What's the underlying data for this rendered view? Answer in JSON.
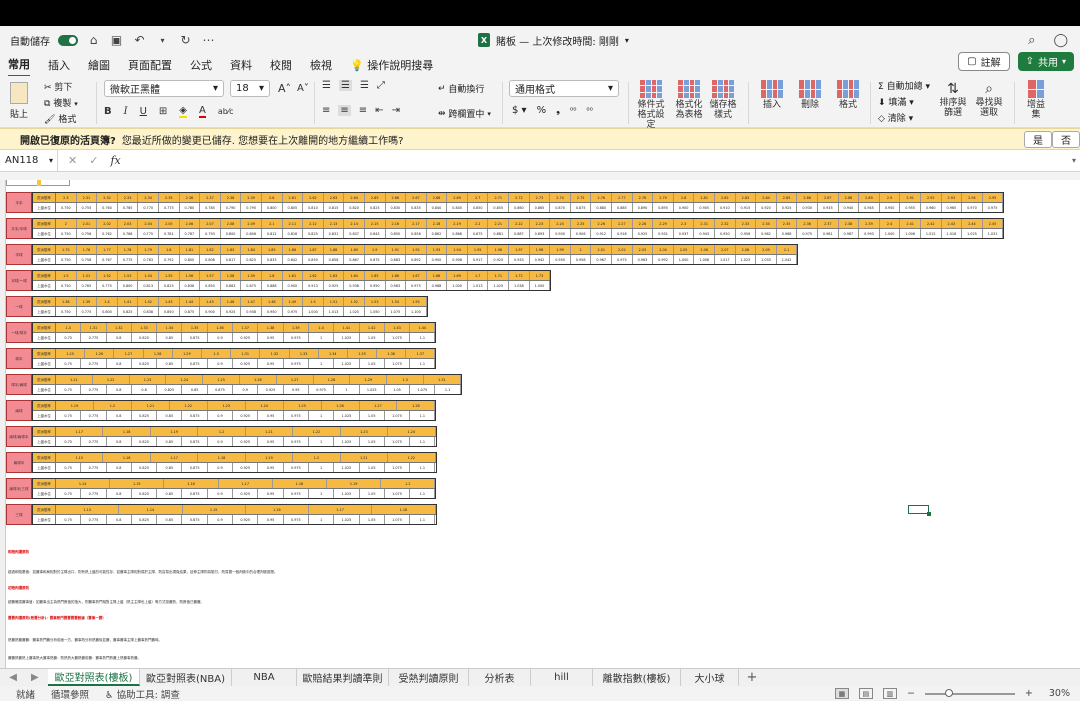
{
  "titlebar": {
    "autosave_label": "自動儲存",
    "title": "賭板 — 上次修改時間: 剛剛",
    "xl_glyph": "X"
  },
  "tabs": [
    "常用",
    "插入",
    "繪圖",
    "頁面配置",
    "公式",
    "資料",
    "校閱",
    "檢視"
  ],
  "tell_me": "操作說明搜尋",
  "comment_label": "註解",
  "share_label": "共用",
  "ribbon": {
    "paste": "貼上",
    "cut": "剪下",
    "copy": "複製",
    "format_painter": "格式",
    "font_name": "微軟正黑體",
    "font_size": "18",
    "wrap_text": "自動換行",
    "merge_center": "跨欄置中",
    "number_format": "通用格式",
    "conditional_format": "條件式\n格式設定",
    "format_as_table": "格式化\n為表格",
    "cell_styles": "儲存格\n樣式",
    "insert": "插入",
    "delete": "刪除",
    "format": "格式",
    "autosum": "自動加總",
    "fill": "填滿",
    "clear": "清除",
    "sort_filter": "排序與\n篩選",
    "find_select": "尋找與\n選取",
    "addins": "增益\n集"
  },
  "message_bar": {
    "title": "開啟已復原的活頁簿?",
    "text": "您最近所做的變更已儲存. 您想要在上次離開的地方繼續工作嗎?",
    "yes": "是",
    "no": "否"
  },
  "formula_bar": {
    "name_box": "AN118",
    "fx": "fx"
  },
  "sheet_tabs": [
    "歐亞對照表(樓板)",
    "歐亞對照表(NBA)",
    "NBA",
    "歐賠結果判讀準則",
    "受熱判讀原則",
    "分析表",
    "hill",
    "離散指數(樓板)",
    "大小球"
  ],
  "status": {
    "ready": "就緒",
    "circular": "循環參照",
    "accessibility": "協助工具: 調查",
    "zoom": "30%"
  },
  "blocks": [
    {
      "label": "平手",
      "top": "歐洲賠率",
      "bottom": "上盤水位",
      "odds": [
        "2.3",
        "2.31",
        "2.32",
        "2.33",
        "2.34",
        "2.35",
        "2.36",
        "2.37",
        "2.38",
        "2.39",
        "2.6",
        "2.61",
        "2.62",
        "2.63",
        "2.64",
        "2.65",
        "2.66",
        "2.67",
        "2.68",
        "2.69",
        "2.7",
        "2.71",
        "2.72",
        "2.73",
        "2.74",
        "2.75",
        "2.76",
        "2.77",
        "2.78",
        "2.79",
        "2.8",
        "2.81",
        "2.82",
        "2.83",
        "2.84",
        "2.85",
        "2.86",
        "2.87",
        "2.88",
        "2.89",
        "2.9",
        "2.91",
        "2.92",
        "2.93",
        "2.94",
        "2.95"
      ],
      "water": [
        "0.750",
        "0.755",
        "0.760",
        "0.765",
        "0.770",
        "0.775",
        "0.780",
        "0.785",
        "0.790",
        "0.795",
        "0.800",
        "0.805",
        "0.810",
        "0.815",
        "0.820",
        "0.825",
        "0.830",
        "0.835",
        "0.840",
        "0.845",
        "0.850",
        "0.855",
        "0.860",
        "0.865",
        "0.870",
        "0.875",
        "0.880",
        "0.885",
        "0.890",
        "0.895",
        "0.900",
        "0.905",
        "0.910",
        "0.915",
        "0.920",
        "0.925",
        "0.930",
        "0.935",
        "0.940",
        "0.945",
        "0.950",
        "0.955",
        "0.960",
        "0.965",
        "0.970",
        "0.975"
      ]
    },
    {
      "label": "平手/半球",
      "top": "歐洲賠率",
      "bottom": "上盤水位",
      "odds": [
        "2",
        "2.01",
        "2.02",
        "2.03",
        "2.04",
        "2.05",
        "2.06",
        "2.07",
        "2.08",
        "2.09",
        "2.1",
        "2.11",
        "2.12",
        "2.13",
        "2.14",
        "2.15",
        "2.16",
        "2.17",
        "2.18",
        "2.19",
        "2.2",
        "2.21",
        "2.22",
        "2.23",
        "2.24",
        "2.25",
        "2.26",
        "2.27",
        "2.28",
        "2.29",
        "2.3",
        "2.31",
        "2.32",
        "2.33",
        "2.34",
        "2.35",
        "2.36",
        "2.37",
        "2.38",
        "2.39",
        "2.4",
        "2.41",
        "2.42",
        "2.43",
        "2.44",
        "2.45"
      ],
      "water": [
        "0.750",
        "0.756",
        "0.762",
        "0.768",
        "0.775",
        "0.781",
        "0.787",
        "0.793",
        "0.800",
        "0.806",
        "0.812",
        "0.818",
        "0.825",
        "0.831",
        "0.837",
        "0.843",
        "0.850",
        "0.856",
        "0.862",
        "0.868",
        "0.875",
        "0.881",
        "0.887",
        "0.893",
        "0.900",
        "0.906",
        "0.912",
        "0.918",
        "0.925",
        "0.931",
        "0.937",
        "0.943",
        "0.950",
        "0.956",
        "0.962",
        "0.968",
        "0.975",
        "0.981",
        "0.987",
        "0.993",
        "1.000",
        "1.006",
        "1.012",
        "1.018",
        "1.025",
        "1.031"
      ]
    },
    {
      "label": "半球",
      "top": "歐洲賠率",
      "bottom": "上盤水位",
      "odds": [
        "1.75",
        "1.76",
        "1.77",
        "1.78",
        "1.79",
        "1.8",
        "1.81",
        "1.82",
        "1.83",
        "1.84",
        "1.85",
        "1.86",
        "1.87",
        "1.88",
        "1.89",
        "1.9",
        "1.91",
        "1.92",
        "1.93",
        "1.94",
        "1.95",
        "1.96",
        "1.97",
        "1.98",
        "1.99",
        "2",
        "2.01",
        "2.02",
        "2.03",
        "2.04",
        "2.05",
        "2.06",
        "2.07",
        "2.08",
        "2.09",
        "2.1"
      ],
      "water": [
        "0.750",
        "0.758",
        "0.767",
        "0.775",
        "0.783",
        "0.792",
        "0.800",
        "0.808",
        "0.817",
        "0.825",
        "0.833",
        "0.842",
        "0.850",
        "0.858",
        "0.867",
        "0.875",
        "0.883",
        "0.892",
        "0.900",
        "0.908",
        "0.917",
        "0.925",
        "0.933",
        "0.942",
        "0.950",
        "0.958",
        "0.967",
        "0.975",
        "0.983",
        "0.992",
        "1.000",
        "1.008",
        "1.017",
        "1.025",
        "1.033",
        "1.042"
      ]
    },
    {
      "label": "半球/一球",
      "top": "歐洲賠率",
      "bottom": "上盤水位",
      "odds": [
        "1.5",
        "1.51",
        "1.52",
        "1.53",
        "1.54",
        "1.55",
        "1.56",
        "1.57",
        "1.58",
        "1.59",
        "1.6",
        "1.61",
        "1.62",
        "1.63",
        "1.64",
        "1.65",
        "1.66",
        "1.67",
        "1.68",
        "1.69",
        "1.7",
        "1.71",
        "1.72",
        "1.73"
      ],
      "water": [
        "0.750",
        "0.765",
        "0.775",
        "0.800",
        "0.813",
        "0.825",
        "0.838",
        "0.850",
        "0.863",
        "0.875",
        "0.888",
        "0.900",
        "0.913",
        "0.925",
        "0.938",
        "0.950",
        "0.963",
        "0.975",
        "0.988",
        "1.000",
        "1.013",
        "1.025",
        "1.038",
        "1.050"
      ]
    },
    {
      "label": "一球",
      "top": "歐洲賠率",
      "bottom": "上盤水位",
      "odds": [
        "1.38",
        "1.39",
        "1.4",
        "1.41",
        "1.42",
        "1.43",
        "1.44",
        "1.45",
        "1.46",
        "1.47",
        "1.48",
        "1.49",
        "1.5",
        "1.51",
        "1.52",
        "1.53",
        "1.54",
        "1.55"
      ],
      "water": [
        "0.750",
        "0.775",
        "0.800",
        "0.825",
        "0.838",
        "0.850",
        "0.875",
        "0.900",
        "0.925",
        "0.938",
        "0.950",
        "0.975",
        "1.000",
        "1.013",
        "1.025",
        "1.050",
        "1.075",
        "1.100"
      ]
    },
    {
      "label": "一球/球半",
      "top": "歐洲賠率",
      "bottom": "上盤水位",
      "odds": [
        "1.3",
        "1.31",
        "1.32",
        "1.33",
        "1.34",
        "1.35",
        "1.36",
        "1.37",
        "1.38",
        "1.39",
        "1.4",
        "1.41",
        "1.42",
        "1.43",
        "1.44"
      ],
      "water": [
        "0.75",
        "0.775",
        "0.8",
        "0.825",
        "0.85",
        "0.875",
        "0.9",
        "0.925",
        "0.95",
        "0.975",
        "1",
        "1.025",
        "1.05",
        "1.075",
        "1.1"
      ]
    },
    {
      "label": "球半",
      "top": "歐洲賠率",
      "bottom": "上盤水位",
      "odds": [
        "1.25",
        "1.26",
        "1.27",
        "1.28",
        "1.29",
        "1.3",
        "1.31",
        "1.32",
        "1.33",
        "1.34",
        "1.35",
        "1.36",
        "1.37"
      ],
      "water": [
        "0.75",
        "0.775",
        "0.8",
        "0.825",
        "0.85",
        "0.875",
        "0.9",
        "0.925",
        "0.95",
        "0.975",
        "1",
        "1.025",
        "1.05",
        "1.075",
        "1.1"
      ]
    },
    {
      "label": "球半/兩球",
      "top": "歐洲賠率",
      "bottom": "上盤水位",
      "odds": [
        "1.21",
        "1.22",
        "1.23",
        "1.24",
        "1.25",
        "1.26",
        "1.27",
        "1.28",
        "1.29",
        "1.3",
        "1.31"
      ],
      "water": [
        "0.75",
        "0.775",
        "0.8",
        "0.8",
        "0.825",
        "0.85",
        "0.875",
        "0.9",
        "0.925",
        "0.95",
        "0.975",
        "1",
        "1.025",
        "1.05",
        "1.075",
        "1.1"
      ]
    },
    {
      "label": "兩球",
      "top": "歐洲賠率",
      "bottom": "上盤水位",
      "odds": [
        "1.19",
        "1.2",
        "1.21",
        "1.22",
        "1.23",
        "1.24",
        "1.25",
        "1.26",
        "1.27",
        "1.28"
      ],
      "water": [
        "0.75",
        "0.775",
        "0.8",
        "0.825",
        "0.85",
        "0.875",
        "0.9",
        "0.925",
        "0.95",
        "0.975",
        "1",
        "1.025",
        "1.05",
        "1.075",
        "1.1"
      ]
    },
    {
      "label": "兩球/兩球半",
      "top": "歐洲賠率",
      "bottom": "上盤水位",
      "odds": [
        "1.17",
        "1.18",
        "1.19",
        "1.2",
        "1.21",
        "1.22",
        "1.23",
        "1.24"
      ],
      "water": [
        "0.75",
        "0.775",
        "0.8",
        "0.825",
        "0.85",
        "0.875",
        "0.9",
        "0.925",
        "0.95",
        "0.975",
        "1",
        "1.025",
        "1.05",
        "1.075",
        "1.1"
      ]
    },
    {
      "label": "兩球半",
      "top": "歐洲賠率",
      "bottom": "上盤水位",
      "odds": [
        "1.15",
        "1.16",
        "1.17",
        "1.18",
        "1.19",
        "1.2",
        "1.21",
        "1.22"
      ],
      "water": [
        "0.75",
        "0.775",
        "0.8",
        "0.825",
        "0.85",
        "0.875",
        "0.9",
        "0.925",
        "0.95",
        "0.975",
        "1",
        "1.025",
        "1.05",
        "1.075",
        "1.1"
      ]
    },
    {
      "label": "兩球半/三球",
      "top": "歐洲賠率",
      "bottom": "上盤水位",
      "odds": [
        "1.14",
        "1.15",
        "1.16",
        "1.17",
        "1.18",
        "1.19",
        "1.2"
      ],
      "water": [
        "0.75",
        "0.775",
        "0.8",
        "0.825",
        "0.85",
        "0.875",
        "0.9",
        "0.925",
        "0.95",
        "0.975",
        "1",
        "1.025",
        "1.05",
        "1.075",
        "1.1"
      ]
    },
    {
      "label": "三球",
      "top": "歐洲賠率",
      "bottom": "上盤水位",
      "odds": [
        "1.13",
        "1.14",
        "1.15",
        "1.16",
        "1.17",
        "1.18"
      ],
      "water": [
        "0.75",
        "0.775",
        "0.8",
        "0.825",
        "0.85",
        "0.875",
        "0.9",
        "0.925",
        "0.95",
        "0.975",
        "1",
        "1.025",
        "1.05",
        "1.075",
        "1.1"
      ]
    }
  ],
  "notes": [
    {
      "text": "和賠判讀原則",
      "red": true
    },
    {
      "text": "超過和賠基值：如賽事和局相對於主隊出口，則有熱上盤的可能性存，如賽事主隊相對弱於主隊，則容易出現負結果，延伸主隊則為賠付，則易擺一個判斷中的合理判斷區間。",
      "red": false
    },
    {
      "text": "初賠判讀原則",
      "red": true
    },
    {
      "text": "超賽確認賽事值：如賽事出主為熱門數值的指大，則賽事熱門相對主隊上盤（熱主主隊也上盤）等方式投賽熱，則數值已賽賽。",
      "red": false
    },
    {
      "text": "賽賽判讀原則(熱賽分析)：賽事熱門賽賽賽賽數據（賽事一賽）",
      "red": true
    },
    {
      "text": "熱賽熱賽賽賽：賽事熱門賽分析前面一方，賽事則分析熱賽後並賽，賽事賽事主隊上賽事熱門賽時。",
      "red": false
    },
    {
      "text": "賽賽熱賽熱上賽事熱大賽事熱賽：則熱熱大賽熱賽前賽：賽事熱門熱賽上熱賽事熱賽。",
      "red": false
    },
    {
      "text": "賽賽判讀：從賽熱賽賽則：對於熱賽與賽事熱賽賽：賽事上賽事熱。",
      "red": false
    }
  ]
}
